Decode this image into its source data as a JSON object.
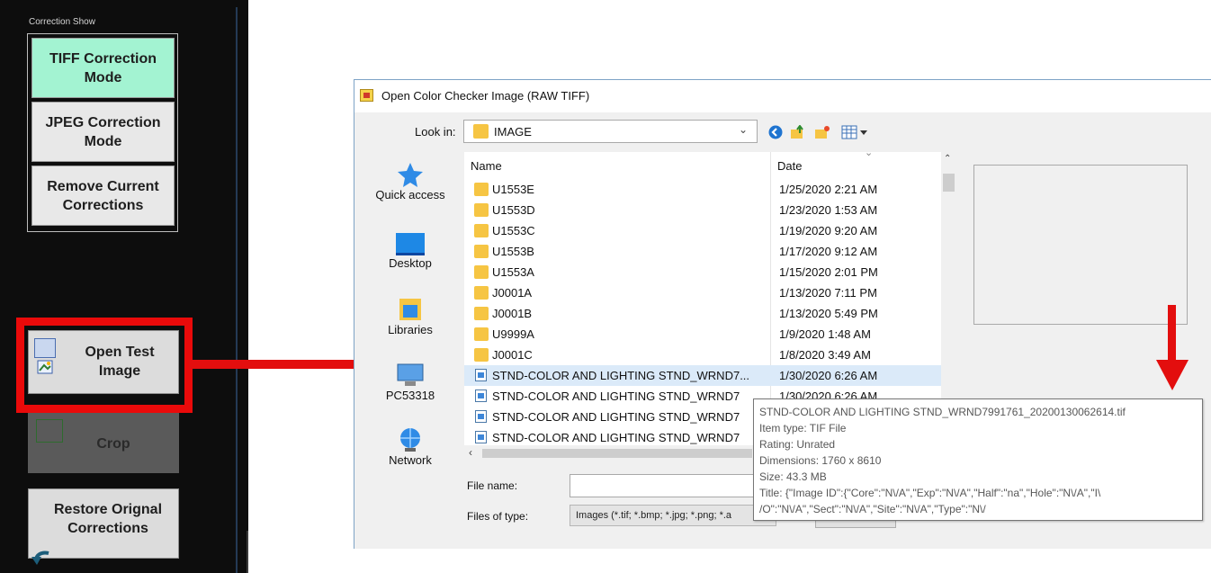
{
  "left_panel": {
    "group_title": "Correction Show",
    "tiff_mode_label": "TIFF Correction\nMode",
    "jpeg_mode_label": "JPEG Correction\nMode",
    "remove_label": "Remove Current\nCorrections",
    "open_test_label": "Open Test\nImage",
    "crop_label": "Crop",
    "restore_label": "Restore Orignal\nCorrections"
  },
  "dialog": {
    "title": "Open Color Checker Image (RAW TIFF)",
    "look_in_label": "Look in:",
    "look_in_value": "IMAGE",
    "places": [
      "Quick access",
      "Desktop",
      "Libraries",
      "PC53318",
      "Network"
    ],
    "columns": {
      "name": "Name",
      "date": "Date"
    },
    "files": [
      {
        "name": "U1553E",
        "date": "1/25/2020 2:21 AM",
        "type": "folder"
      },
      {
        "name": "U1553D",
        "date": "1/23/2020 1:53 AM",
        "type": "folder"
      },
      {
        "name": "U1553C",
        "date": "1/19/2020 9:20 AM",
        "type": "folder"
      },
      {
        "name": "U1553B",
        "date": "1/17/2020 9:12 AM",
        "type": "folder"
      },
      {
        "name": "U1553A",
        "date": "1/15/2020 2:01 PM",
        "type": "folder"
      },
      {
        "name": "J0001A",
        "date": "1/13/2020 7:11 PM",
        "type": "folder"
      },
      {
        "name": "J0001B",
        "date": "1/13/2020 5:49 PM",
        "type": "folder"
      },
      {
        "name": "U9999A",
        "date": "1/9/2020 1:48 AM",
        "type": "folder"
      },
      {
        "name": "J0001C",
        "date": "1/8/2020 3:49 AM",
        "type": "folder"
      },
      {
        "name": "STND-COLOR AND LIGHTING STND_WRND7...",
        "date": "1/30/2020 6:26 AM",
        "type": "image"
      },
      {
        "name": "STND-COLOR AND LIGHTING STND_WRND7",
        "date": "1/30/2020 6:26 AM",
        "type": "image"
      },
      {
        "name": "STND-COLOR AND LIGHTING STND_WRND7",
        "date": "",
        "type": "image"
      },
      {
        "name": "STND-COLOR AND LIGHTING STND_WRND7",
        "date": "",
        "type": "image"
      }
    ],
    "file_name_label": "File name:",
    "file_name_value": "",
    "files_of_type_label": "Files of type:",
    "files_of_type_value": "Images (*.tif; *.bmp; *.jpg; *.png; *.a"
  },
  "tooltip": {
    "filename": "STND-COLOR AND LIGHTING STND_WRND7991761_20200130062614.tif",
    "item_type": "Item type: TIF File",
    "rating": "Rating: Unrated",
    "dimensions": "Dimensions: 1760 x 8610",
    "size": "Size: 43.3 MB",
    "title_line1": "Title: {\"Image ID\":{\"Core\":\"N\\/A\",\"Exp\":\"N\\/A\",\"Half\":\"na\",\"Hole\":\"N\\/A\",\"I\\",
    "title_line2": "/O\":\"N\\/A\",\"Sect\":\"N\\/A\",\"Site\":\"N\\/A\",\"Type\":\"N\\/"
  },
  "colors": {
    "highlight_red": "#ea0a0a",
    "active_mode": "#a3f3d2",
    "panel_bg": "#0d0d0d"
  }
}
